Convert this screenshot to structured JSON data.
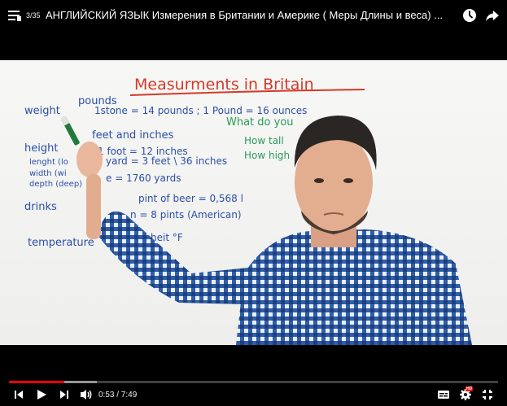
{
  "header": {
    "playlist_count": "3/35",
    "video_title": "АНГЛИЙСКИЙ ЯЗЫК Измерения в Британии и Америке ( Меры Длины и веса) ..."
  },
  "video": {
    "board_heading": "Measurments in Britain",
    "board_lines": {
      "weight": "weight",
      "pounds": "pounds",
      "stone": "1stone = 14 pounds ; 1 Pound = 16 ounces",
      "what_do_you": "What do you",
      "height": "height",
      "feet_inches": "feet and inches",
      "foot": "1 foot = 12 inches",
      "yard": "yard = 3 feet \\ 36 inches",
      "how_tall": "How tall",
      "how_high": "How high",
      "lenght": "lenght (lo",
      "width": "width (wi",
      "depth": "depth (deep)",
      "mile": "e = 1760 yards",
      "drinks": "drinks",
      "pint": "pint of beer = 0,568 l",
      "gallon": "n = 8 pints (American)",
      "temperature": "temperature",
      "fahrenheit": "heit  °F"
    }
  },
  "player": {
    "current_time": "0:53",
    "separator": "/",
    "duration": "7:49",
    "time_label": "0:53 / 7:49",
    "played_fraction": 0.113,
    "buffered_fraction": 0.18,
    "hd_label": "HD",
    "accent_color": "#ff0000"
  }
}
